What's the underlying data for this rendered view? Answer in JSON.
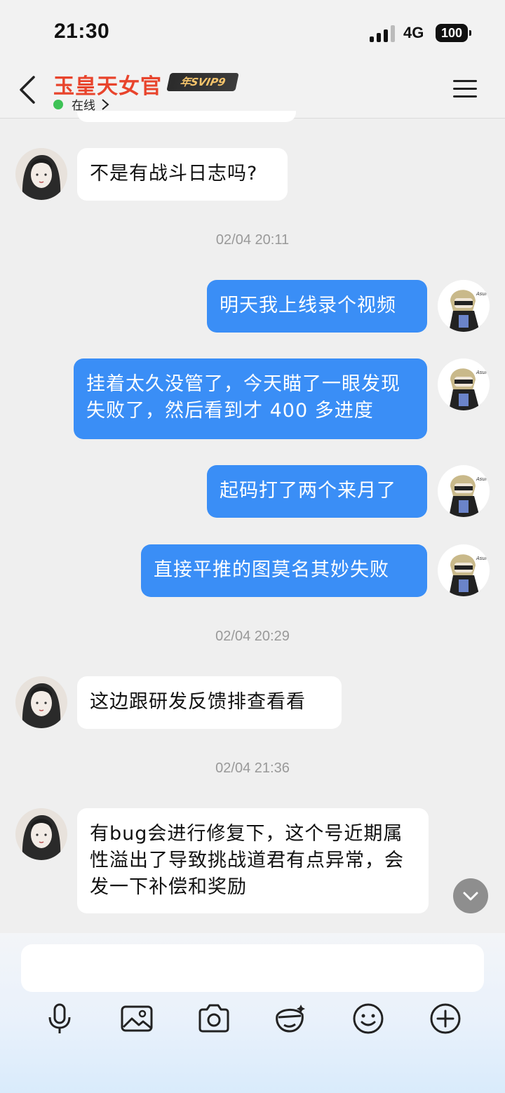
{
  "status_bar": {
    "time": "21:30",
    "network": "4G",
    "battery": "100"
  },
  "header": {
    "contact_name": "玉皇天女官",
    "badge": "年SVIP9",
    "online_status": "在线",
    "status_dot_color": "#3ec256",
    "name_color": "#e8442c"
  },
  "messages": [
    {
      "side": "in",
      "text": "不是有战斗日志吗?"
    },
    {
      "timestamp": "02/04 20:11"
    },
    {
      "side": "out",
      "text": "明天我上线录个视频"
    },
    {
      "side": "out",
      "text": "挂着太久没管了，今天瞄了一眼发现失败了，然后看到才 400 多进度"
    },
    {
      "side": "out",
      "text": "起码打了两个来月了"
    },
    {
      "side": "out",
      "text": "直接平推的图莫名其妙失败"
    },
    {
      "timestamp": "02/04 20:29"
    },
    {
      "side": "in",
      "text": "这边跟研发反馈排查看看"
    },
    {
      "timestamp": "02/04 21:36"
    },
    {
      "side": "in",
      "text": "有bug会进行修复下，这个号近期属性溢出了导致挑战道君有点异常，会发一下补偿和奖励"
    }
  ],
  "avatars": {
    "self_label": "Asuna"
  },
  "toolbar": [
    "microphone-icon",
    "image-icon",
    "camera-icon",
    "sticker-icon",
    "emoji-icon",
    "plus-icon"
  ],
  "colors": {
    "outgoing_bubble": "#3a8ef6",
    "incoming_bubble": "#ffffff",
    "background": "#efefef"
  }
}
